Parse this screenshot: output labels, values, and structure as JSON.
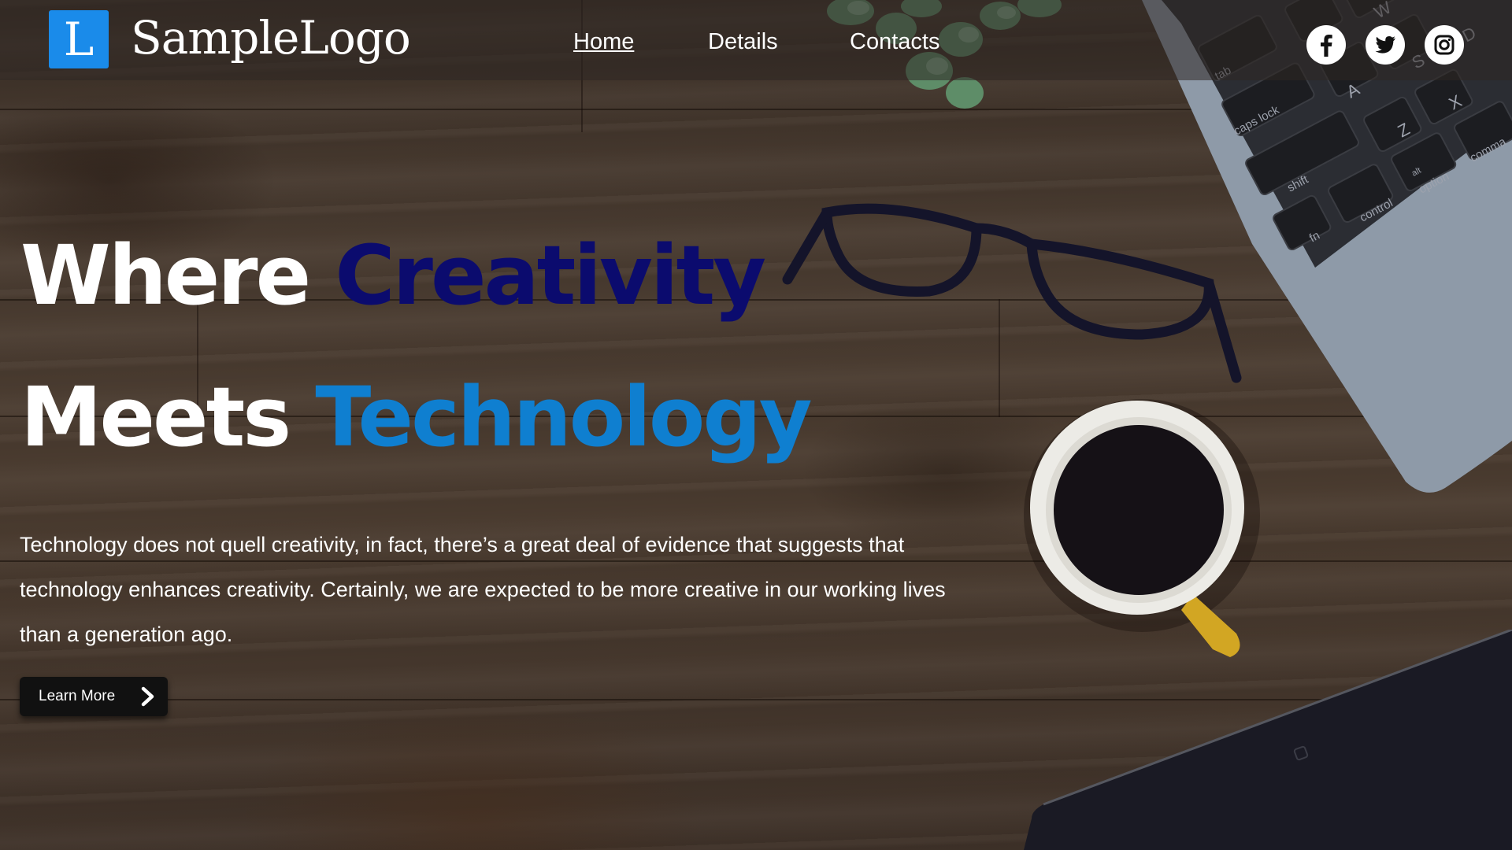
{
  "brand": {
    "logo_letter": "L",
    "logo_text": "SampleLogo"
  },
  "nav": {
    "items": [
      {
        "label": "Home",
        "active": true
      },
      {
        "label": "Details",
        "active": false
      },
      {
        "label": "Contacts",
        "active": false
      }
    ]
  },
  "social": [
    "facebook-icon",
    "twitter-icon",
    "instagram-icon"
  ],
  "hero": {
    "line1_white": "Where",
    "line1_accent": "Creativity",
    "line2_white": "Meets",
    "line2_accent": "Technology",
    "body_line1": "Technology does not quell creativity, in fact, there’s a great deal of evidence that suggests that",
    "body_line2": "technology enhances creativity. Certainly, we are expected to be more creative in our working lives",
    "body_line3": "than a generation ago.",
    "cta_label": "Learn More",
    "cta_icon": "chevron-right-icon"
  },
  "colors": {
    "logo_blue": "#1a8bea",
    "accent_navy": "#0b0b6e",
    "accent_blue": "#0f7fd0",
    "cta_bg": "#111111"
  },
  "keyboard_keys": [
    "tab",
    "caps lock",
    "A",
    "S",
    "D",
    "W",
    "Z",
    "X",
    "shift",
    "fn",
    "control",
    "option",
    "alt",
    "comma"
  ]
}
